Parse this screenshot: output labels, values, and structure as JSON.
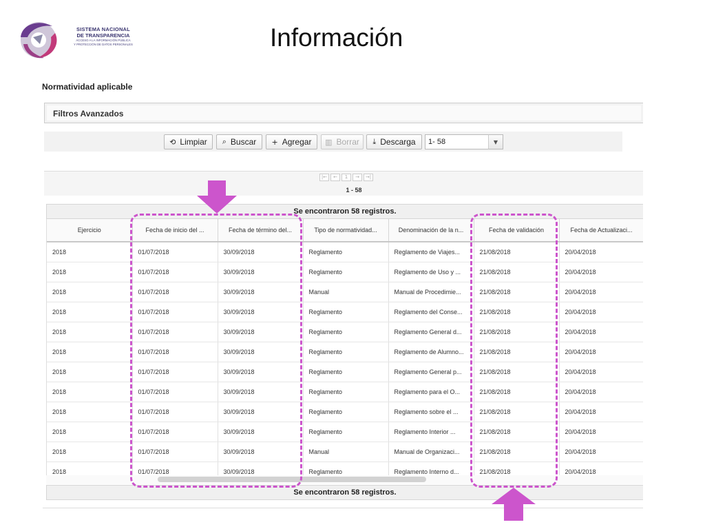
{
  "logo": {
    "line1": "Sistema Nacional",
    "line2": "de Transparencia",
    "line3": "Acceso a la Información Pública",
    "line4": "y Protección de Datos Personales"
  },
  "slide_title": "Información",
  "section_title": "Normatividad aplicable",
  "filters": {
    "label": "Filtros Avanzados"
  },
  "toolbar": {
    "clear_label": "Limpiar",
    "search_label": "Buscar",
    "add_label": "Agregar",
    "delete_label": "Borrar",
    "download_label": "Descarga",
    "range_value": "1- 58",
    "icons": {
      "clear": "refresh-icon",
      "search": "search-icon",
      "add": "plus-icon",
      "delete": "trash-icon",
      "download": "download-icon"
    }
  },
  "pager": {
    "current_page": "1",
    "range_text": "1 - 58"
  },
  "results": {
    "found_text": "Se encontraron 58 registros."
  },
  "table": {
    "columns": [
      "Ejercicio",
      "Fecha de inicio del ...",
      "Fecha de término del...",
      "Tipo de normatividad...",
      "Denominación de la n...",
      "Fecha de validación",
      "Fecha de Actualizaci..."
    ],
    "rows": [
      [
        "2018",
        "01/07/2018",
        "30/09/2018",
        "Reglamento",
        "Reglamento de Viajes...",
        "21/08/2018",
        "20/04/2018"
      ],
      [
        "2018",
        "01/07/2018",
        "30/09/2018",
        "Reglamento",
        "Reglamento de Uso y ...",
        "21/08/2018",
        "20/04/2018"
      ],
      [
        "2018",
        "01/07/2018",
        "30/09/2018",
        "Manual",
        "Manual de Procedimie...",
        "21/08/2018",
        "20/04/2018"
      ],
      [
        "2018",
        "01/07/2018",
        "30/09/2018",
        "Reglamento",
        "Reglamento del Conse...",
        "21/08/2018",
        "20/04/2018"
      ],
      [
        "2018",
        "01/07/2018",
        "30/09/2018",
        "Reglamento",
        "Reglamento General d...",
        "21/08/2018",
        "20/04/2018"
      ],
      [
        "2018",
        "01/07/2018",
        "30/09/2018",
        "Reglamento",
        "Reglamento de Alumno...",
        "21/08/2018",
        "20/04/2018"
      ],
      [
        "2018",
        "01/07/2018",
        "30/09/2018",
        "Reglamento",
        "Reglamento General p...",
        "21/08/2018",
        "20/04/2018"
      ],
      [
        "2018",
        "01/07/2018",
        "30/09/2018",
        "Reglamento",
        "Reglamento para el O...",
        "21/08/2018",
        "20/04/2018"
      ],
      [
        "2018",
        "01/07/2018",
        "30/09/2018",
        "Reglamento",
        "Reglamento sobre el ...",
        "21/08/2018",
        "20/04/2018"
      ],
      [
        "2018",
        "01/07/2018",
        "30/09/2018",
        "Reglamento",
        "Reglamento Interior ...",
        "21/08/2018",
        "20/04/2018"
      ],
      [
        "2018",
        "01/07/2018",
        "30/09/2018",
        "Manual",
        "Manual de Organizaci...",
        "21/08/2018",
        "20/04/2018"
      ],
      [
        "2018",
        "01/07/2018",
        "30/09/2018",
        "Reglamento",
        "Reglamento Interno d...",
        "21/08/2018",
        "20/04/2018"
      ]
    ]
  },
  "colors": {
    "annotation": "#cc55cc",
    "logo_purple": "#6a3d8f",
    "logo_pink": "#c23a7a",
    "logo_navy": "#3a3570"
  }
}
